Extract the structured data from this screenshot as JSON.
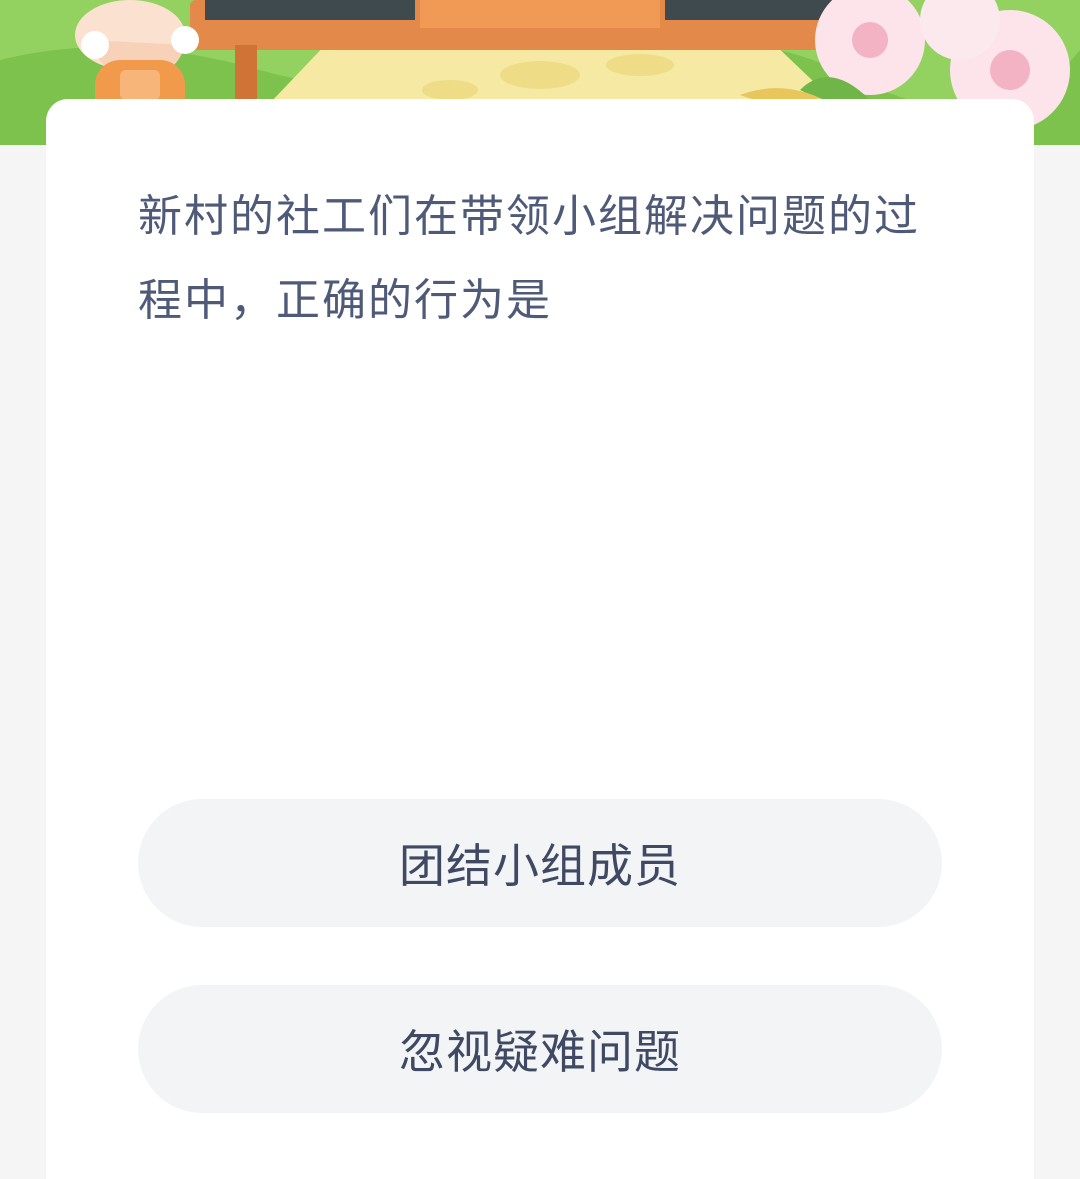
{
  "question": {
    "text": "新村的社工们在带领小组解决问题的过程中，正确的行为是"
  },
  "options": [
    {
      "label": "团结小组成员"
    },
    {
      "label": "忽视疑难问题"
    }
  ],
  "colors": {
    "page_background": "#f5f5f6",
    "card_background": "#ffffff",
    "question_text": "#4e5a78",
    "option_background": "#f3f4f6",
    "option_text": "#3f4963",
    "banner_green": "#8fcf5e"
  },
  "icons": {
    "banner": "cartoon-character-with-blackboard-and-flowers"
  }
}
